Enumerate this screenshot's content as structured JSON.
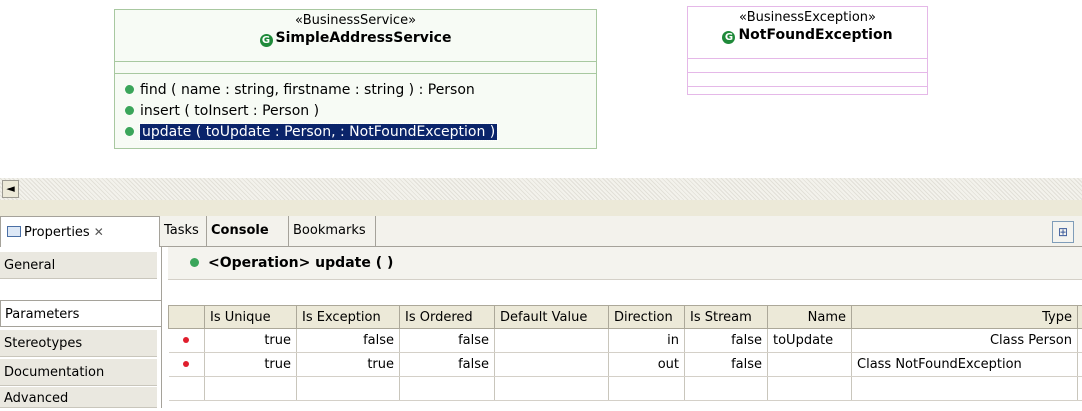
{
  "diagram": {
    "service_class": {
      "stereotype": "«BusinessService»",
      "icon_glyph": "G",
      "name": "SimpleAddressService",
      "operations": [
        "find ( name : string, firstname : string ) : Person",
        "insert ( toInsert : Person )",
        "update ( toUpdate : Person,  : NotFoundException )"
      ]
    },
    "exception_class": {
      "stereotype": "«BusinessException»",
      "icon_glyph": "G",
      "name": "NotFoundException"
    }
  },
  "scrollbar": {
    "left_arrow": "◄"
  },
  "tabs": [
    {
      "label": "Properties",
      "close": "✕"
    },
    {
      "label": "Tasks"
    },
    {
      "label": "Console"
    },
    {
      "label": "Bookmarks"
    }
  ],
  "toolbar": {
    "tree_button": "⊞"
  },
  "sidebar": {
    "items": [
      "General",
      "Parameters",
      "Stereotypes",
      "Documentation",
      "Advanced"
    ],
    "selected": "Parameters"
  },
  "content": {
    "title": "<Operation> update ( )"
  },
  "parameters_table": {
    "columns": [
      "Is Unique",
      "Is Exception",
      "Is Ordered",
      "Default Value",
      "Direction",
      "Is Stream",
      "Name",
      "Type"
    ],
    "rows": [
      [
        "true",
        "false",
        "false",
        "",
        "in",
        "false",
        "toUpdate",
        "Class Person"
      ],
      [
        "true",
        "true",
        "false",
        "",
        "out",
        "false",
        "",
        "Class NotFoundException"
      ]
    ]
  },
  "colors": {
    "uml_green": "#1f8a3a",
    "selection": "#0a246a",
    "param_dot": "#e01e2d",
    "exception_border": "#e5b8e8"
  }
}
